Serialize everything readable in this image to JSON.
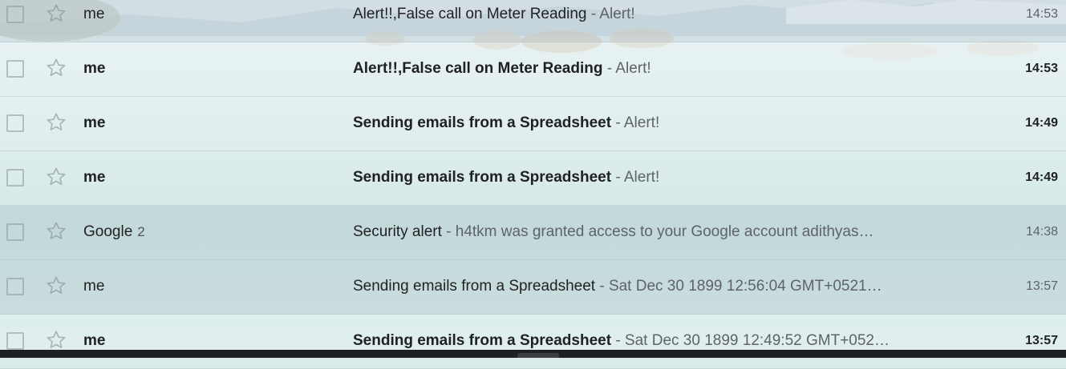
{
  "emails": [
    {
      "sender": "me",
      "count": "",
      "subject": "Alert!!,False call on Meter Reading",
      "snippet": " - Alert!",
      "time": "14:53",
      "unread": false
    },
    {
      "sender": "me",
      "count": "",
      "subject": "Alert!!,False call on Meter Reading",
      "snippet": " - Alert!",
      "time": "14:53",
      "unread": true
    },
    {
      "sender": "me",
      "count": "",
      "subject": "Sending emails from a Spreadsheet",
      "snippet": " - Alert!",
      "time": "14:49",
      "unread": true
    },
    {
      "sender": "me",
      "count": "",
      "subject": "Sending emails from a Spreadsheet",
      "snippet": " - Alert!",
      "time": "14:49",
      "unread": true
    },
    {
      "sender": "Google",
      "count": "2",
      "subject": "Security alert",
      "snippet": " - h4tkm was granted access to your Google account adithyas…",
      "time": "14:38",
      "unread": false
    },
    {
      "sender": "me",
      "count": "",
      "subject": "Sending emails from a Spreadsheet",
      "snippet": " - Sat Dec 30 1899 12:56:04 GMT+0521…",
      "time": "13:57",
      "unread": false
    },
    {
      "sender": "me",
      "count": "",
      "subject": "Sending emails from a Spreadsheet",
      "snippet": " - Sat Dec 30 1899 12:49:52 GMT+052…",
      "time": "13:57",
      "unread": true
    }
  ],
  "icons": {
    "checkbox": "checkbox-icon",
    "star": "star-icon"
  },
  "colors": {
    "unread_text": "#202124",
    "snippet": "#5f6368",
    "background_water": "#9fc6c4"
  }
}
